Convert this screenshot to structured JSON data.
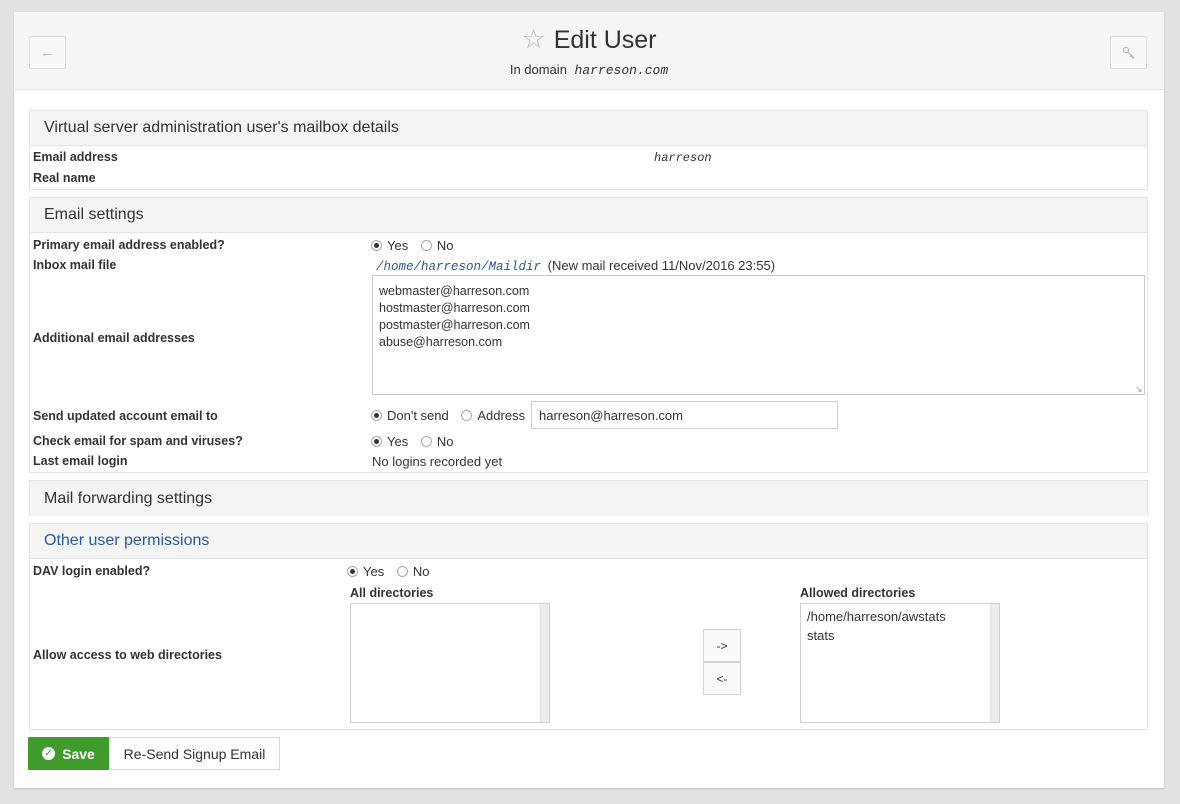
{
  "header": {
    "back_icon": "arrow-left-icon",
    "title": "Edit User",
    "star_icon": "star-outline-icon",
    "subtitle_prefix": "In domain",
    "domain": "harreson.com",
    "key_icon": "key-icon"
  },
  "mailbox": {
    "title": "Virtual server administration user's mailbox details",
    "email_label": "Email address",
    "email_value": "harreson",
    "realname_label": "Real name"
  },
  "email_settings": {
    "title": "Email settings",
    "primary_label": "Primary email address enabled?",
    "primary_yes": "Yes",
    "primary_no": "No",
    "inbox_label": "Inbox mail file",
    "inbox_path": "/home/harreson/Maildir",
    "inbox_note": "(New mail received 11/Nov/2016 23:55)",
    "additional_label": "Additional email addresses",
    "additional_addresses": [
      "webmaster@harreson.com",
      "hostmaster@harreson.com",
      "postmaster@harreson.com",
      "abuse@harreson.com"
    ],
    "send_label": "Send updated account email to",
    "send_dont": "Don't send",
    "send_address": "Address",
    "send_address_value": "harreson@harreson.com",
    "spam_label": "Check email for spam and viruses?",
    "spam_yes": "Yes",
    "spam_no": "No",
    "last_login_label": "Last email login",
    "last_login_value": "No logins recorded yet"
  },
  "forwarding": {
    "title": "Mail forwarding settings"
  },
  "permissions": {
    "title": "Other user permissions",
    "dav_label": "DAV login enabled?",
    "dav_yes": "Yes",
    "dav_no": "No",
    "webdir_label": "Allow access to web directories",
    "all_dirs_label": "All directories",
    "allowed_dirs_label": "Allowed directories",
    "allowed_dirs": [
      "/home/harreson/awstats",
      "stats"
    ],
    "add_button": "->",
    "remove_button": "<-"
  },
  "actions": {
    "save": "Save",
    "resend": "Re-Send Signup Email"
  },
  "colors": {
    "save_green": "#3e9b2c",
    "section_title_blue": "#2a5a9b",
    "header_bg": "#f5f5f5"
  }
}
